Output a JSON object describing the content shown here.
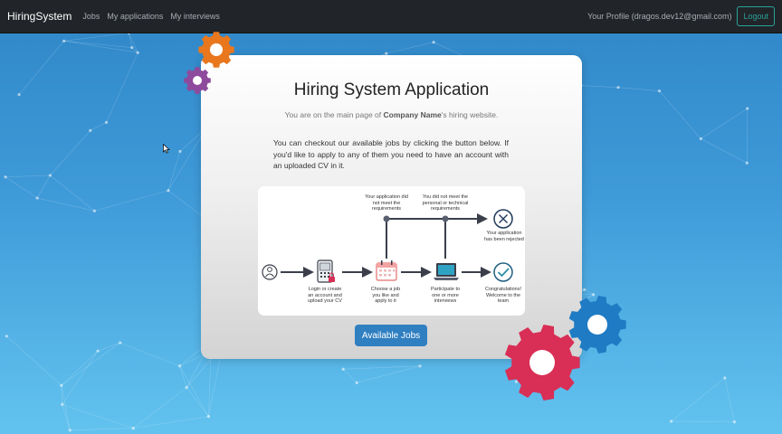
{
  "navbar": {
    "brand": "HiringSystem",
    "links": [
      "Jobs",
      "My applications",
      "My interviews"
    ],
    "profile": "Your Profile (dragos.dev12@gmail.com)",
    "logout": "Logout"
  },
  "card": {
    "title": "Hiring System Application",
    "subtitle_prefix": "You are on the main page of ",
    "company": "Company Name",
    "subtitle_suffix": "'s hiring website.",
    "description": "You can checkout our available jobs by clicking the button below. If you'd like to apply to any of them you need to have an account with an uploaded CV in it.",
    "button": "Available Jobs"
  },
  "flow": {
    "step_login": "Login or create an account and upload your CV",
    "step_choose": "Choose a job you like and apply to it",
    "step_interview": "Participate to one or more interviews",
    "step_success": "Congratulations! Welcome to the team",
    "branch_requirements": "Your application did not meet the requirements",
    "branch_personal": "You did not meet the personal or technical requirements",
    "rejected": "Your application has been rejected"
  },
  "colors": {
    "navbar": "#212529",
    "button": "#2f7fc1",
    "gear_orange": "#e8771e",
    "gear_purple": "#8e4a9c",
    "gear_blue": "#1f7bc3",
    "gear_red": "#d92e55",
    "success": "#2a8fa6"
  },
  "icons": [
    "user-icon",
    "phone-lock-icon",
    "calendar-icon",
    "laptop-icon",
    "check-circle-icon",
    "x-circle-icon",
    "gear-icon"
  ]
}
